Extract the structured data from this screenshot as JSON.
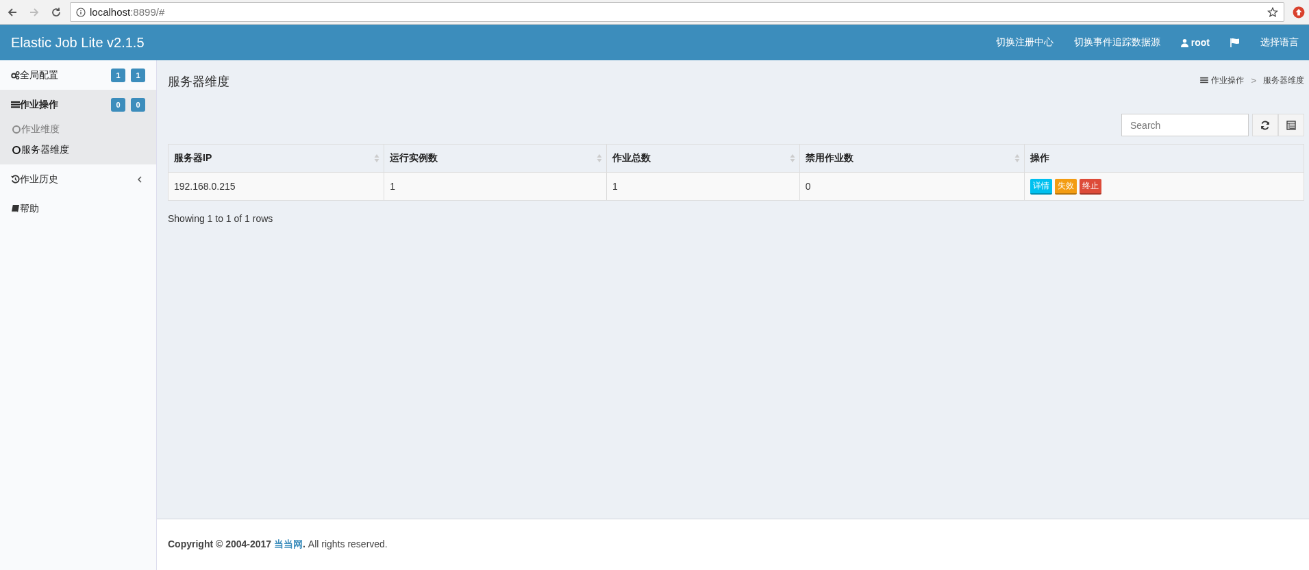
{
  "browser": {
    "url_host": "localhost",
    "url_rest": ":8899/#"
  },
  "header": {
    "brand": "Elastic Job Lite v2.1.5",
    "nav": [
      {
        "kind": "link",
        "label": "切换注册中心"
      },
      {
        "kind": "link",
        "label": "切换事件追踪数据源"
      },
      {
        "kind": "user",
        "label": "root"
      },
      {
        "kind": "flag"
      },
      {
        "kind": "link",
        "label": "选择语言"
      }
    ]
  },
  "sidebar": {
    "items": [
      {
        "label": "全局配置",
        "badges": [
          "1",
          "1"
        ],
        "expanded": false
      },
      {
        "label": "作业操作",
        "badges": [
          "0",
          "0"
        ],
        "expanded": true,
        "children": [
          {
            "label": "作业维度",
            "selected": false
          },
          {
            "label": "服务器维度",
            "selected": true
          }
        ]
      },
      {
        "label": "作业历史",
        "expanded": false,
        "has_chevron": true
      },
      {
        "label": "帮助",
        "expanded": false,
        "has_chevron": false
      }
    ]
  },
  "page": {
    "title": "服务器维度",
    "breadcrumb": [
      "作业操作",
      "服务器维度"
    ],
    "breadcrumb_separator": ">"
  },
  "toolbar": {
    "search": {
      "placeholder": "Search"
    }
  },
  "table": {
    "columns": [
      {
        "label": "服务器IP",
        "sortable": true
      },
      {
        "label": "运行实例数",
        "sortable": true
      },
      {
        "label": "作业总数",
        "sortable": true
      },
      {
        "label": "禁用作业数",
        "sortable": true
      },
      {
        "label": "操作",
        "sortable": false
      }
    ],
    "rows": [
      {
        "cells": [
          "192.168.0.215",
          "1",
          "1",
          "0"
        ],
        "actions": [
          {
            "kind": "info",
            "label": "详情"
          },
          {
            "kind": "warning",
            "label": "失效"
          },
          {
            "kind": "danger",
            "label": "终止"
          }
        ]
      }
    ]
  },
  "pagination_info": "Showing 1 to 1 of 1 rows",
  "footer": {
    "prefix": "Copyright © 2004-2017 ",
    "link": "当当网",
    "suffix_bold": ".",
    "suffix": " All rights reserved."
  }
}
